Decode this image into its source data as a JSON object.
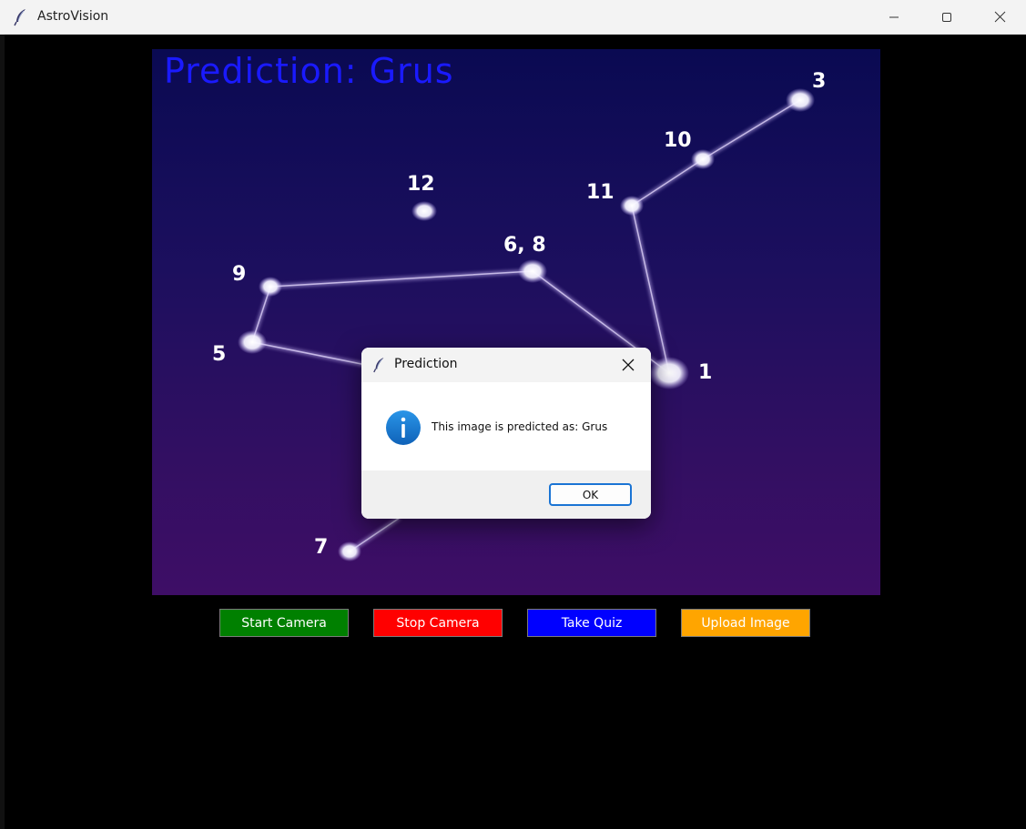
{
  "window": {
    "title": "AstroVision"
  },
  "canvas": {
    "prediction_text": "Prediction:  Grus",
    "star_labels": [
      "3",
      "10",
      "11",
      "12",
      "6, 8",
      "9",
      "5",
      "1",
      "7"
    ]
  },
  "controls": {
    "start_camera": "Start Camera",
    "stop_camera": "Stop Camera",
    "take_quiz": "Take Quiz",
    "upload_image": "Upload Image"
  },
  "dialog": {
    "title": "Prediction",
    "message": "This image is predicted as: Grus",
    "ok_label": "OK"
  },
  "colors": {
    "start_camera": "#008000",
    "stop_camera": "#ff0000",
    "take_quiz": "#0000ff",
    "upload_image": "#ffa500",
    "prediction_text": "#1a1aff",
    "info_icon": "#1a7fd4"
  },
  "icons": {
    "app": "feather-icon",
    "minimize": "minimize-icon",
    "maximize": "maximize-icon",
    "close": "close-icon",
    "info": "info-icon"
  }
}
